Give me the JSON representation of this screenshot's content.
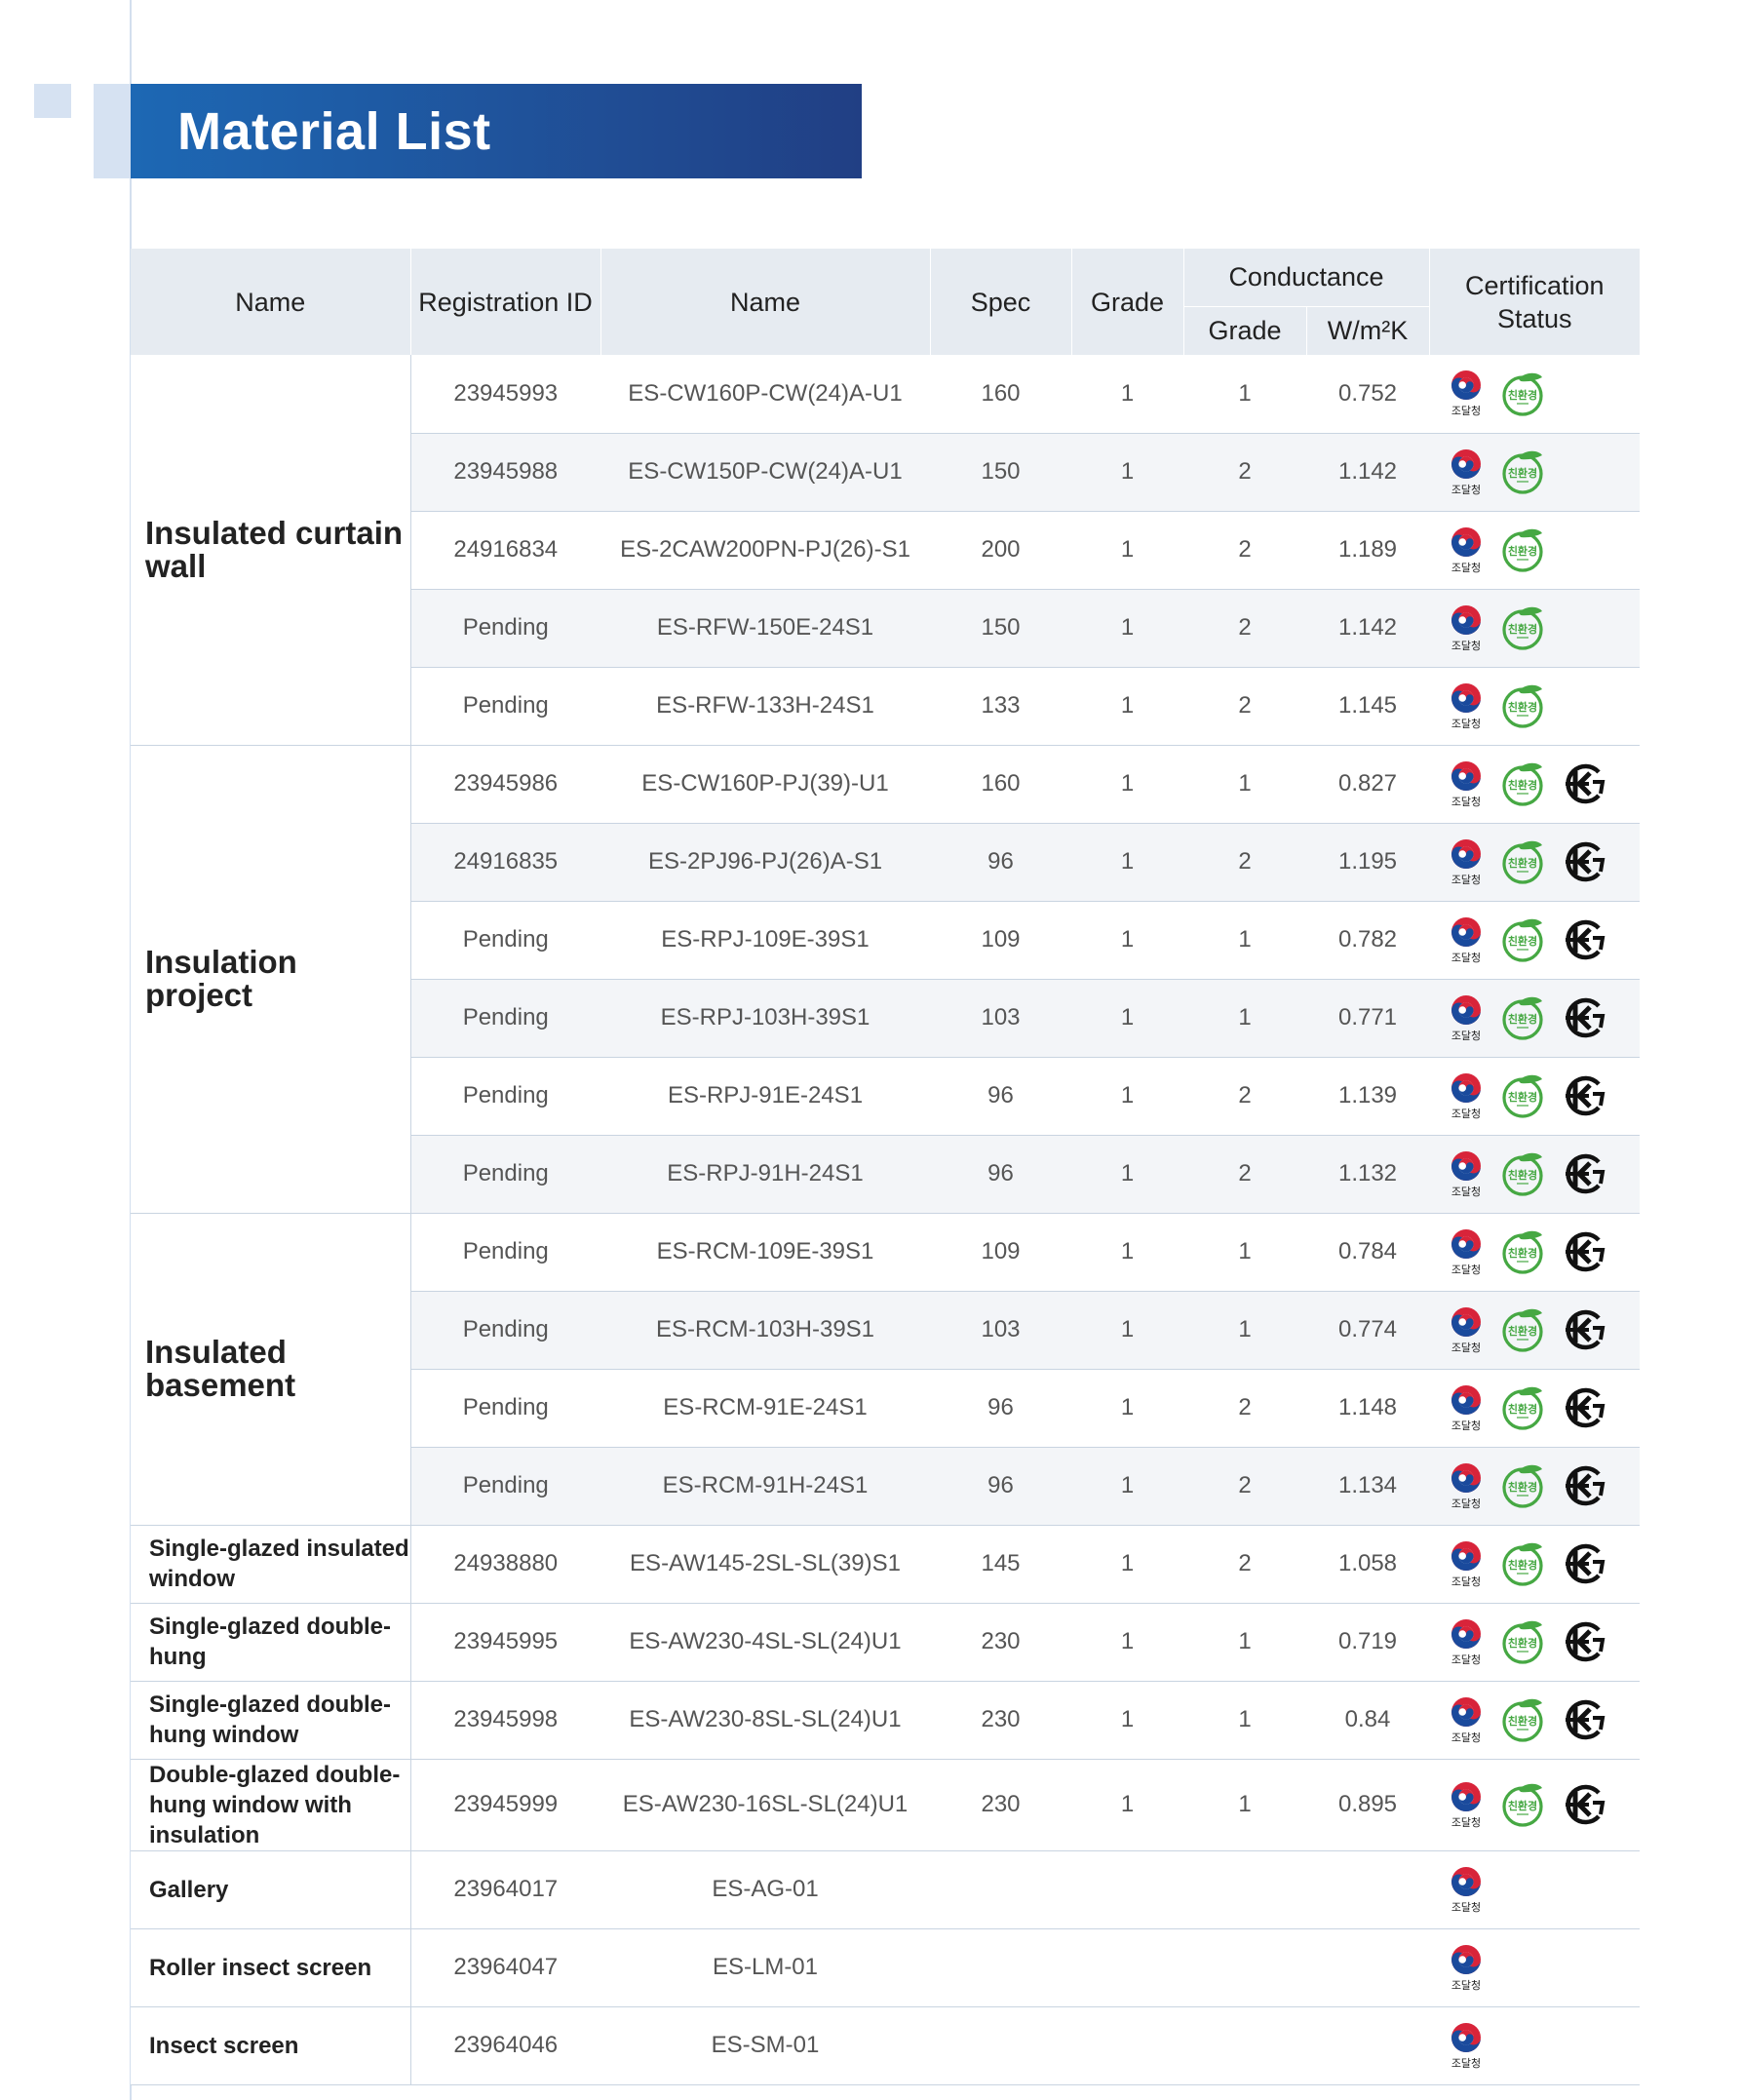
{
  "title": "Material List",
  "headers": {
    "name": "Name",
    "registration_id": "Registration ID",
    "product_name": "Name",
    "spec": "Spec",
    "grade": "Grade",
    "conductance": "Conductance",
    "conductance_grade": "Grade",
    "conductance_wm2k": "W/m²K",
    "certification_status": "Certification Status"
  },
  "badge_labels": {
    "pps": "조달청",
    "eco": "친환경"
  },
  "colors": {
    "banner_start": "#1d68b4",
    "banner_end": "#213f84",
    "eco_green": "#46a843",
    "header_bg": "#e6ebf1"
  },
  "groups": [
    {
      "label": "Insulated curtain wall",
      "style": "large",
      "rows": [
        {
          "id": "23945993",
          "name": "ES-CW160P-CW(24)A-U1",
          "spec": "160",
          "grade": "1",
          "cgrade": "1",
          "wm2k": "0.752",
          "certs": [
            "pps-icon",
            "eco-icon"
          ]
        },
        {
          "id": "23945988",
          "name": "ES-CW150P-CW(24)A-U1",
          "spec": "150",
          "grade": "1",
          "cgrade": "2",
          "wm2k": "1.142",
          "certs": [
            "pps-icon",
            "eco-icon"
          ]
        },
        {
          "id": "24916834",
          "name": "ES-2CAW200PN-PJ(26)-S1",
          "spec": "200",
          "grade": "1",
          "cgrade": "2",
          "wm2k": "1.189",
          "certs": [
            "pps-icon",
            "eco-icon"
          ]
        },
        {
          "id": "Pending",
          "name": "ES-RFW-150E-24S1",
          "spec": "150",
          "grade": "1",
          "cgrade": "2",
          "wm2k": "1.142",
          "certs": [
            "pps-icon",
            "eco-icon"
          ]
        },
        {
          "id": "Pending",
          "name": "ES-RFW-133H-24S1",
          "spec": "133",
          "grade": "1",
          "cgrade": "2",
          "wm2k": "1.145",
          "certs": [
            "pps-icon",
            "eco-icon"
          ]
        }
      ]
    },
    {
      "label": "Insulation project",
      "style": "large",
      "rows": [
        {
          "id": "23945986",
          "name": "ES-CW160P-PJ(39)-U1",
          "spec": "160",
          "grade": "1",
          "cgrade": "1",
          "wm2k": "0.827",
          "certs": [
            "pps-icon",
            "eco-icon",
            "kc-icon"
          ]
        },
        {
          "id": "24916835",
          "name": "ES-2PJ96-PJ(26)A-S1",
          "spec": "96",
          "grade": "1",
          "cgrade": "2",
          "wm2k": "1.195",
          "certs": [
            "pps-icon",
            "eco-icon",
            "kc-icon"
          ]
        },
        {
          "id": "Pending",
          "name": "ES-RPJ-109E-39S1",
          "spec": "109",
          "grade": "1",
          "cgrade": "1",
          "wm2k": "0.782",
          "certs": [
            "pps-icon",
            "eco-icon",
            "kc-icon"
          ]
        },
        {
          "id": "Pending",
          "name": "ES-RPJ-103H-39S1",
          "spec": "103",
          "grade": "1",
          "cgrade": "1",
          "wm2k": "0.771",
          "certs": [
            "pps-icon",
            "eco-icon",
            "kc-icon"
          ]
        },
        {
          "id": "Pending",
          "name": "ES-RPJ-91E-24S1",
          "spec": "96",
          "grade": "1",
          "cgrade": "2",
          "wm2k": "1.139",
          "certs": [
            "pps-icon",
            "eco-icon",
            "kc-icon"
          ]
        },
        {
          "id": "Pending",
          "name": "ES-RPJ-91H-24S1",
          "spec": "96",
          "grade": "1",
          "cgrade": "2",
          "wm2k": "1.132",
          "certs": [
            "pps-icon",
            "eco-icon",
            "kc-icon"
          ]
        }
      ]
    },
    {
      "label": "Insulated basement",
      "style": "large",
      "rows": [
        {
          "id": "Pending",
          "name": "ES-RCM-109E-39S1",
          "spec": "109",
          "grade": "1",
          "cgrade": "1",
          "wm2k": "0.784",
          "certs": [
            "pps-icon",
            "eco-icon",
            "kc-icon"
          ]
        },
        {
          "id": "Pending",
          "name": "ES-RCM-103H-39S1",
          "spec": "103",
          "grade": "1",
          "cgrade": "1",
          "wm2k": "0.774",
          "certs": [
            "pps-icon",
            "eco-icon",
            "kc-icon"
          ]
        },
        {
          "id": "Pending",
          "name": "ES-RCM-91E-24S1",
          "spec": "96",
          "grade": "1",
          "cgrade": "2",
          "wm2k": "1.148",
          "certs": [
            "pps-icon",
            "eco-icon",
            "kc-icon"
          ]
        },
        {
          "id": "Pending",
          "name": "ES-RCM-91H-24S1",
          "spec": "96",
          "grade": "1",
          "cgrade": "2",
          "wm2k": "1.134",
          "certs": [
            "pps-icon",
            "eco-icon",
            "kc-icon"
          ]
        }
      ]
    },
    {
      "label": "Single-glazed insulated window",
      "style": "small",
      "rows": [
        {
          "id": "24938880",
          "name": "ES-AW145-2SL-SL(39)S1",
          "spec": "145",
          "grade": "1",
          "cgrade": "2",
          "wm2k": "1.058",
          "certs": [
            "pps-icon",
            "eco-icon",
            "kc-icon"
          ]
        }
      ]
    },
    {
      "label": "Single-glazed double-hung",
      "style": "small",
      "rows": [
        {
          "id": "23945995",
          "name": "ES-AW230-4SL-SL(24)U1",
          "spec": "230",
          "grade": "1",
          "cgrade": "1",
          "wm2k": "0.719",
          "certs": [
            "pps-icon",
            "eco-icon",
            "kc-icon"
          ]
        }
      ]
    },
    {
      "label": "Single-glazed double-hung window",
      "style": "small",
      "rows": [
        {
          "id": "23945998",
          "name": "ES-AW230-8SL-SL(24)U1",
          "spec": "230",
          "grade": "1",
          "cgrade": "1",
          "wm2k": "0.84",
          "certs": [
            "pps-icon",
            "eco-icon",
            "kc-icon"
          ]
        }
      ]
    },
    {
      "label": "Double-glazed double-hung window with insulation",
      "style": "small",
      "rows": [
        {
          "id": "23945999",
          "name": "ES-AW230-16SL-SL(24)U1",
          "spec": "230",
          "grade": "1",
          "cgrade": "1",
          "wm2k": "0.895",
          "certs": [
            "pps-icon",
            "eco-icon",
            "kc-icon"
          ]
        }
      ]
    },
    {
      "label": "Gallery",
      "style": "small",
      "rows": [
        {
          "id": "23964017",
          "name": "ES-AG-01",
          "spec": "",
          "grade": "",
          "cgrade": "",
          "wm2k": "",
          "certs": [
            "pps-icon"
          ]
        }
      ]
    },
    {
      "label": "Roller insect screen",
      "style": "small",
      "rows": [
        {
          "id": "23964047",
          "name": "ES-LM-01",
          "spec": "",
          "grade": "",
          "cgrade": "",
          "wm2k": "",
          "certs": [
            "pps-icon"
          ]
        }
      ]
    },
    {
      "label": "Insect screen",
      "style": "small",
      "rows": [
        {
          "id": "23964046",
          "name": "ES-SM-01",
          "spec": "",
          "grade": "",
          "cgrade": "",
          "wm2k": "",
          "certs": [
            "pps-icon"
          ]
        }
      ]
    }
  ]
}
